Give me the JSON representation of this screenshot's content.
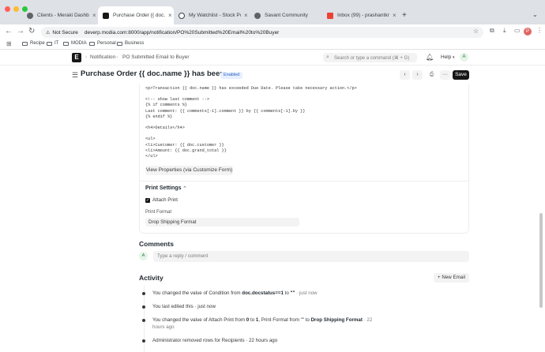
{
  "browser": {
    "tabs": [
      {
        "title": "Clients - Meraki Dashboard",
        "active": false,
        "color": "#5f6368"
      },
      {
        "title": "Purchase Order {{ doc.name",
        "active": true,
        "color": "#171717"
      },
      {
        "title": "My Watchlist - Stock Portfoli",
        "active": false,
        "color": "#3c4043"
      },
      {
        "title": "Savant Community",
        "active": false,
        "color": "#5f6368"
      },
      {
        "title": "Inbox (99) - prashantkmody@",
        "active": false,
        "color": "#ea4335"
      }
    ],
    "security": "Not Secure",
    "url": "deverp.modia.com:8000/app/notification/PO%20Submitted%20Email%20to%20Buyer",
    "bookmarks": [
      "Recipe",
      "IT",
      "MODIA",
      "Personal",
      "Business"
    ],
    "profile_initial": "P"
  },
  "app": {
    "breadcrumb": [
      "Notification",
      "PO Submitted Email to Buyer"
    ],
    "search_placeholder": "Search or type a command (⌘ + G)",
    "help_label": "Help",
    "user_initial": "A"
  },
  "header": {
    "title": "Purchase Order {{ doc.name }} has been s...",
    "status": "Enabled",
    "save_label": "Save"
  },
  "code_lines": [
    "<p>Transaction {{ doc.name }} has exceeded Due Date. Please take necessary action.</p>",
    "",
    "<!-- show last comment -->",
    "{% if comments %}",
    "Last comment: {{ comments[-1].comment }} by {{ comments[-1].by }}",
    "{% endif %}",
    "",
    "<h4>Details</h4>",
    "",
    "<ul>",
    "<li>Customer: {{ doc.customer }}",
    "<li>Amount: {{ doc.grand_total }}",
    "</ul>"
  ],
  "view_properties_label": "View Properties (via Customize Form)",
  "print_settings": {
    "heading": "Print Settings",
    "attach_print_label": "Attach Print",
    "attach_print_checked": true,
    "print_format_label": "Print Format",
    "print_format_value": "Drop Shipping Format"
  },
  "comments": {
    "heading": "Comments",
    "avatar_initial": "A",
    "placeholder": "Type a reply / comment"
  },
  "activity": {
    "heading": "Activity",
    "new_email_label": "+ New Email",
    "items": [
      {
        "pre": "You changed the value of Condition from ",
        "b1": "doc.docstatus==1",
        "mid": " to ",
        "b2": "\"\"",
        "post": " · just now"
      },
      {
        "pre": "You last edited this · just now",
        "b1": "",
        "mid": "",
        "b2": "",
        "post": ""
      },
      {
        "pre": "You changed the value of Attach Print from ",
        "b1": "0",
        "mid": " to ",
        "b2": "1",
        "post": ", Print Format from \"\" to ",
        "b3": "Drop Shipping Format",
        "post2": " · 22",
        "line2": "hours ago"
      },
      {
        "pre": "Administrator removed rows for Recipients · 22 hours ago",
        "b1": "",
        "mid": "",
        "b2": "",
        "post": ""
      }
    ]
  }
}
